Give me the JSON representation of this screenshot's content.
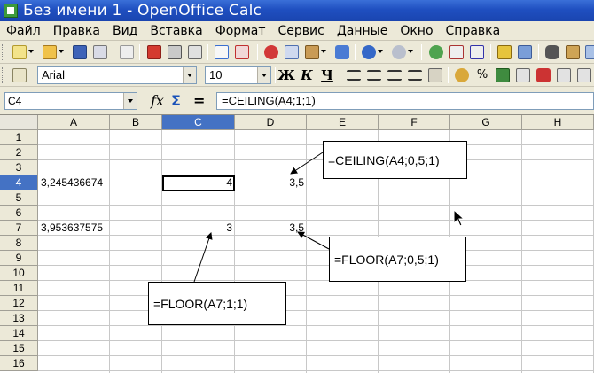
{
  "window": {
    "title": "Без имени 1 - OpenOffice Calc"
  },
  "menu": [
    "Файл",
    "Правка",
    "Вид",
    "Вставка",
    "Формат",
    "Сервис",
    "Данные",
    "Окно",
    "Справка"
  ],
  "formatting": {
    "font_name": "Arial",
    "font_size": "10",
    "bold": "Ж",
    "italic": "К",
    "underline": "Ч"
  },
  "formula_bar": {
    "name_box": "C4",
    "fx": "fx",
    "sum": "Σ",
    "equals": "=",
    "formula": "=CEILING(A4;1;1)"
  },
  "grid": {
    "columns": [
      "A",
      "B",
      "C",
      "D",
      "E",
      "F",
      "G",
      "H"
    ],
    "active_column": "C",
    "rows": [
      "1",
      "2",
      "3",
      "4",
      "5",
      "6",
      "7",
      "8",
      "9",
      "10",
      "11",
      "12",
      "13",
      "14",
      "15",
      "16"
    ],
    "active_row": "4",
    "cells": {
      "A4": "3,245436674",
      "C4": "4",
      "D4": "3,5",
      "A7": "3,953637575",
      "C7": "3",
      "D7": "3,5"
    }
  },
  "callouts": {
    "ceiling": "=CEILING(A4;0,5;1)",
    "floor_half": "=FLOOR(A7;0,5;1)",
    "floor_one": "=FLOOR(A7;1;1)"
  },
  "colors": {
    "titlebar": "#1f4fc0",
    "active_header": "#4472c4"
  }
}
